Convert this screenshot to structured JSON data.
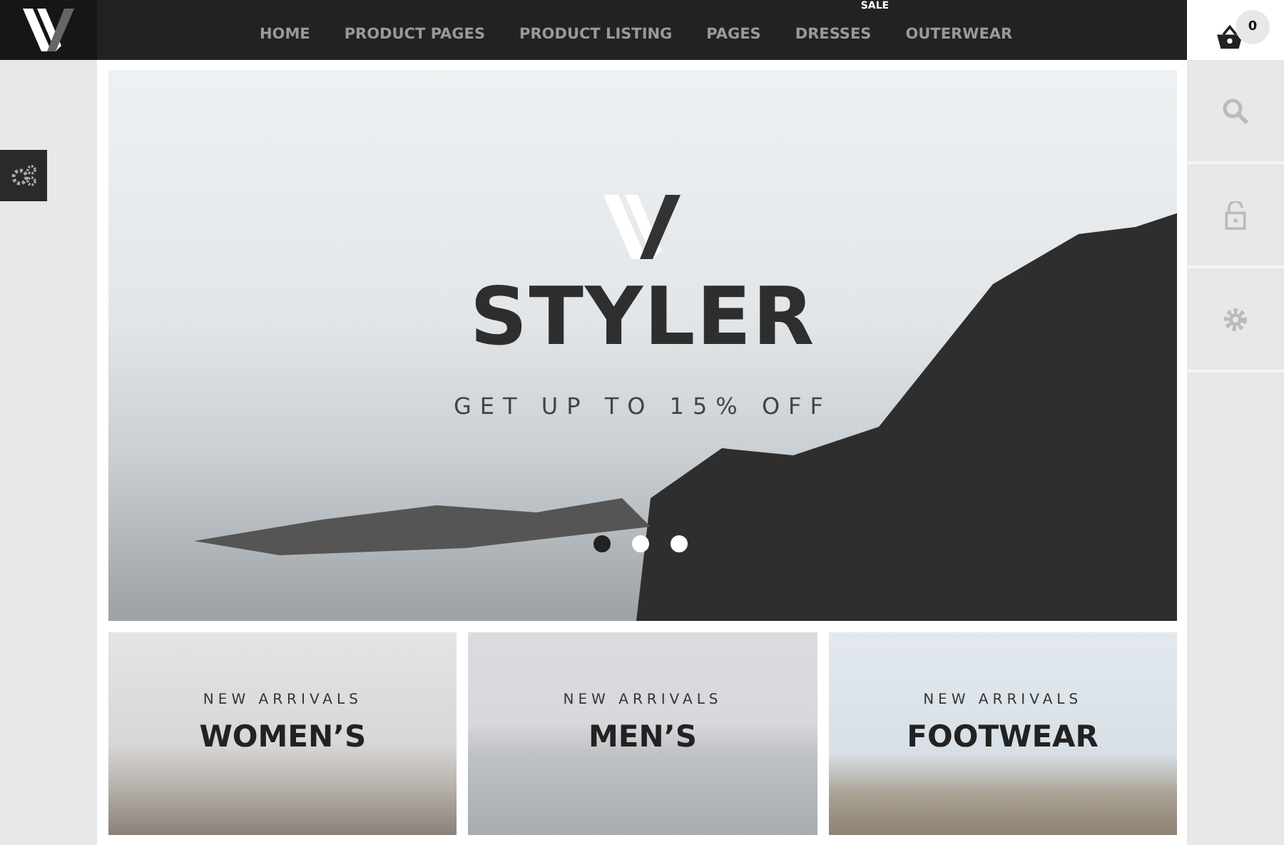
{
  "nav": [
    {
      "label": "HOME"
    },
    {
      "label": "PRODUCT PAGES"
    },
    {
      "label": "PRODUCT LISTING"
    },
    {
      "label": "PAGES"
    },
    {
      "label": "DRESSES",
      "badge": "SALE"
    },
    {
      "label": "OUTERWEAR"
    }
  ],
  "cart": {
    "count": "0"
  },
  "hero": {
    "title": "STYLER",
    "subtitle": "GET UP TO 15% OFF",
    "dots": [
      {
        "selected": true
      },
      {
        "selected": false
      },
      {
        "selected": false
      }
    ]
  },
  "categories": [
    {
      "eyebrow": "NEW ARRIVALS",
      "title": "WOMEN’S"
    },
    {
      "eyebrow": "NEW ARRIVALS",
      "title": "MEN’S"
    },
    {
      "eyebrow": "NEW ARRIVALS",
      "title": "FOOTWEAR"
    }
  ]
}
